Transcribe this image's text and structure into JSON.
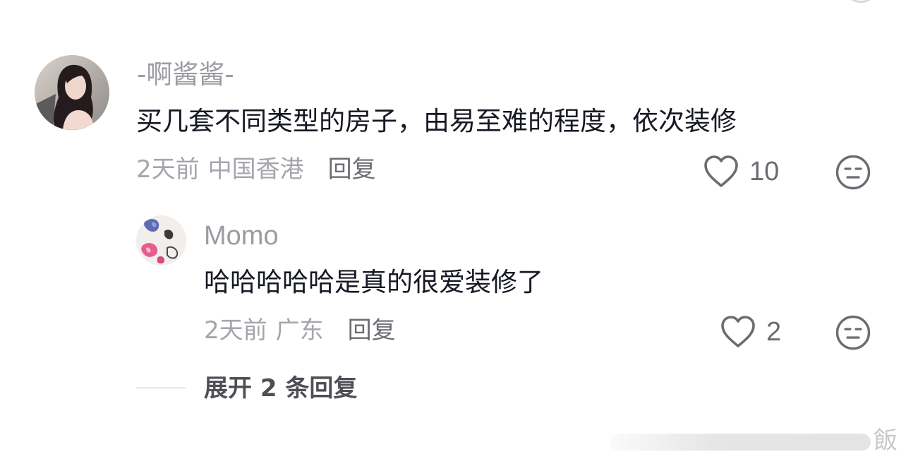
{
  "comment": {
    "username": "-啊酱酱-",
    "text": "买几套不同类型的房子，由易至难的程度，依次装修",
    "time": "2天前",
    "location": "中国香港",
    "reply_label": "回复",
    "likes": "10"
  },
  "reply": {
    "username": "Momo",
    "text": "哈哈哈哈哈是真的很爱装修了",
    "time": "2天前",
    "location": "广东",
    "reply_label": "回复",
    "likes": "2"
  },
  "expand_label": "展开 2 条回复",
  "watermark": {
    "glyph": "飯"
  },
  "icons": {
    "like": "heart-outline-icon",
    "reaction": "neutral-face-icon"
  },
  "colors": {
    "text_primary": "#161823",
    "text_secondary": "#a5a6ab",
    "icon": "#6b6c72"
  }
}
